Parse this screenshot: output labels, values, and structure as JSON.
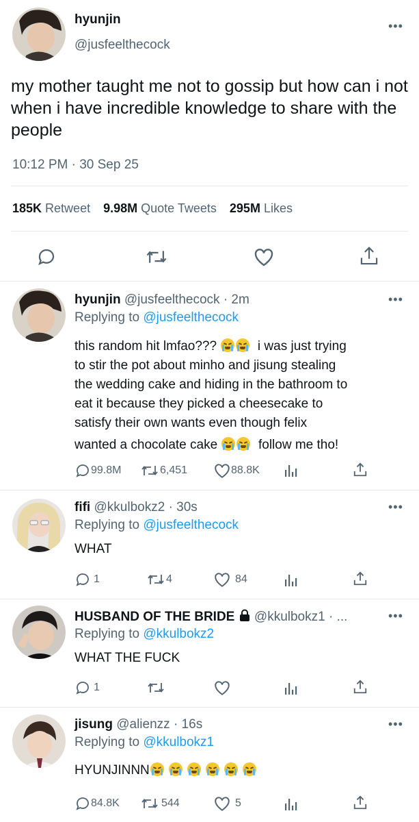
{
  "main_tweet": {
    "display_name": "hyunjin",
    "handle": "@jusfeelthecock",
    "text": "my mother taught me not to gossip but how can i not when i have incredible knowledge to share with the people",
    "timestamp": "10:12 PM · 30 Sep 25",
    "stats": {
      "retweets_count": "185K",
      "retweets_label": "Retweet",
      "quotes_count": "9.98M",
      "quotes_label": "Quote Tweets",
      "likes_count": "295M",
      "likes_label": "Likes"
    }
  },
  "replies": [
    {
      "display_name": "hyunjin",
      "handle": "@jusfeelthecock",
      "time": "· 2m",
      "replying_prefix": "Replying to",
      "replying_to": "@jusfeelthecock",
      "line1_pre": "this random hit lmfao???",
      "line1_post": "i was just trying",
      "line2": "to stir the pot about minho and jisung stealing",
      "line3": "the wedding cake and hiding in the bathroom to",
      "line4": "eat it because they picked a cheesecake to",
      "line5": "satisfy their own wants even though felix",
      "line6_pre": "wanted a chocolate cake",
      "line6_post": "follow me tho!",
      "replies_count": "99.8M",
      "retweets_count": "6,451",
      "likes_count": "88.8K"
    },
    {
      "display_name": "fifi",
      "handle": "@kkulbokz2",
      "time": "· 30s",
      "replying_prefix": "Replying to",
      "replying_to": "@jusfeelthecock",
      "text": "WHAT",
      "replies_count": "1",
      "retweets_count": "4",
      "likes_count": "84"
    },
    {
      "display_name": "HUSBAND OF THE BRIDE",
      "handle": "@kkulbokz1",
      "time": "· ...",
      "replying_prefix": "Replying to",
      "replying_to": "@kkulbokz2",
      "text": "WHAT THE FUCK",
      "replies_count": "1",
      "retweets_count": "",
      "likes_count": ""
    },
    {
      "display_name": "jisung",
      "handle": "@alienzz",
      "time": "· 16s",
      "replying_prefix": "Replying to",
      "replying_to": "@kkulbokz1",
      "text": "HYUNJINNN",
      "replies_count": "84.8K",
      "retweets_count": "544",
      "likes_count": "5"
    }
  ],
  "icons": {
    "more": "more-icon",
    "reply": "reply-icon",
    "retweet": "retweet-icon",
    "like": "heart-icon",
    "share": "share-icon",
    "analytics": "analytics-icon",
    "lock": "lock-icon",
    "emoji": "loudly-crying-face-icon"
  },
  "colors": {
    "accent": "#1d9bf0",
    "secondary_text": "#536471",
    "text": "#0f1419",
    "divider": "#e6e9ec"
  }
}
